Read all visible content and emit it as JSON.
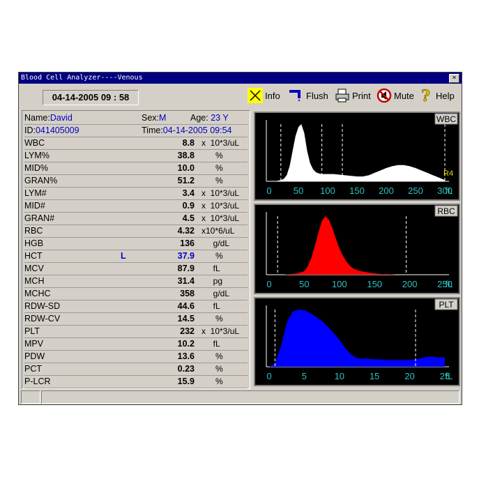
{
  "window": {
    "title": "Blood Cell Analyzer----Venous",
    "close": "×"
  },
  "datetime": "04-14-2005  09 : 58",
  "toolbar": {
    "info": "Info",
    "flush": "Flush",
    "print": "Print",
    "mute": "Mute",
    "help": "Help"
  },
  "patient": {
    "name_label": "Name:",
    "name": "David",
    "sex_label": "Sex:",
    "sex": "M",
    "age_label": "Age:",
    "age": "23 Y",
    "id_label": "ID:",
    "id": "041405009",
    "time_label": "Time:",
    "time": "04-14-2005 09:54"
  },
  "results": [
    {
      "label": "WBC",
      "flag": "",
      "value": "8.8",
      "unit": "x  10*3/uL"
    },
    {
      "label": "LYM%",
      "flag": "",
      "value": "38.8",
      "unit": "      %"
    },
    {
      "label": "MID%",
      "flag": "",
      "value": "10.0",
      "unit": "      %"
    },
    {
      "label": "GRAN%",
      "flag": "",
      "value": "51.2",
      "unit": "      %"
    },
    {
      "label": "LYM#",
      "flag": "",
      "value": "3.4",
      "unit": "x  10*3/uL"
    },
    {
      "label": "MID#",
      "flag": "",
      "value": "0.9",
      "unit": "x  10*3/uL"
    },
    {
      "label": "GRAN#",
      "flag": "",
      "value": "4.5",
      "unit": "x  10*3/uL"
    },
    {
      "label": "RBC",
      "flag": "",
      "value": "4.32",
      "unit": "x10*6/uL"
    },
    {
      "label": "HGB",
      "flag": "",
      "value": "136",
      "unit": "     g/dL"
    },
    {
      "label": "HCT",
      "flag": "L",
      "value": "37.9",
      "unit": "      %",
      "highlight": true
    },
    {
      "label": "MCV",
      "flag": "",
      "value": "87.9",
      "unit": "     fL"
    },
    {
      "label": "MCH",
      "flag": "",
      "value": "31.4",
      "unit": "     pg"
    },
    {
      "label": "MCHC",
      "flag": "",
      "value": "358",
      "unit": "     g/dL"
    },
    {
      "label": "RDW-SD",
      "flag": "",
      "value": "44.6",
      "unit": "     fL"
    },
    {
      "label": "RDW-CV",
      "flag": "",
      "value": "14.5",
      "unit": "      %"
    },
    {
      "label": "PLT",
      "flag": "",
      "value": "232",
      "unit": "x  10*3/uL"
    },
    {
      "label": "MPV",
      "flag": "",
      "value": "10.2",
      "unit": "     fL"
    },
    {
      "label": "PDW",
      "flag": "",
      "value": "13.6",
      "unit": "      %"
    },
    {
      "label": "PCT",
      "flag": "",
      "value": "0.23",
      "unit": "      %"
    },
    {
      "label": "P-LCR",
      "flag": "",
      "value": "15.9",
      "unit": "      %"
    }
  ],
  "chart_data": [
    {
      "type": "area",
      "title": "WBC",
      "color": "#ffffff",
      "x_ticks": [
        "0",
        "50",
        "100",
        "150",
        "200",
        "250",
        "300",
        "fL"
      ],
      "xlim": [
        0,
        300
      ],
      "markers": [
        20,
        90,
        125,
        300
      ],
      "marker_label": "R4",
      "x": [
        0,
        10,
        20,
        25,
        30,
        35,
        40,
        45,
        50,
        55,
        60,
        65,
        70,
        75,
        80,
        85,
        90,
        95,
        100,
        110,
        120,
        130,
        140,
        150,
        160,
        170,
        180,
        190,
        200,
        210,
        220,
        230,
        240,
        250,
        260,
        270,
        280,
        290,
        300
      ],
      "y": [
        0,
        0,
        2,
        4,
        10,
        25,
        50,
        75,
        90,
        95,
        80,
        50,
        30,
        20,
        15,
        13,
        12,
        12,
        12,
        12,
        11,
        10,
        9,
        8,
        8,
        10,
        14,
        18,
        22,
        25,
        27,
        27,
        25,
        22,
        18,
        14,
        10,
        6,
        2
      ]
    },
    {
      "type": "area",
      "title": "RBC",
      "color": "#ff0000",
      "x_ticks": [
        "0",
        "50",
        "100",
        "150",
        "200",
        "250",
        "fL"
      ],
      "xlim": [
        0,
        250
      ],
      "markers": [
        12,
        195
      ],
      "x": [
        0,
        20,
        40,
        50,
        55,
        60,
        65,
        70,
        75,
        80,
        85,
        90,
        95,
        100,
        105,
        110,
        115,
        120,
        130,
        140,
        150,
        160,
        170,
        180,
        190,
        200,
        250
      ],
      "y": [
        0,
        0,
        2,
        6,
        14,
        28,
        48,
        70,
        90,
        98,
        92,
        78,
        60,
        44,
        32,
        22,
        15,
        10,
        6,
        4,
        2,
        1,
        1,
        0,
        0,
        0,
        0
      ]
    },
    {
      "type": "area",
      "title": "PLT",
      "color": "#0000ff",
      "x_ticks": [
        "0",
        "5",
        "10",
        "15",
        "20",
        "25",
        "fL"
      ],
      "xlim": [
        0,
        30
      ],
      "markers": [
        1,
        25
      ],
      "x": [
        0,
        1,
        2,
        3,
        4,
        5,
        6,
        7,
        8,
        9,
        10,
        11,
        12,
        13,
        14,
        15,
        16,
        17,
        18,
        19,
        20,
        21,
        22,
        23,
        24,
        25,
        26,
        27,
        28,
        29,
        30
      ],
      "y": [
        0,
        5,
        30,
        65,
        82,
        85,
        84,
        80,
        74,
        68,
        60,
        50,
        40,
        28,
        18,
        13,
        12,
        12,
        11,
        11,
        10,
        10,
        10,
        10,
        10,
        11,
        13,
        15,
        15,
        14,
        14
      ]
    }
  ]
}
